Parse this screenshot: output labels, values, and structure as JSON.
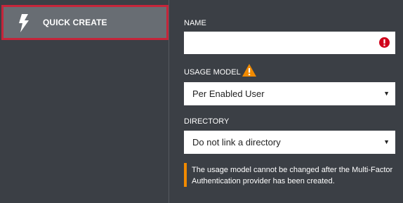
{
  "sidebar": {
    "quick_create_label": "QUICK CREATE",
    "icon": "lightning-bolt-icon",
    "highlight_color": "#c5253a"
  },
  "form": {
    "name_label": "NAME",
    "name_value": "",
    "name_error_icon": "error-icon",
    "usage_model_label": "USAGE MODEL",
    "usage_model_warning_icon": "warning-icon",
    "usage_model_value": "Per Enabled User",
    "directory_label": "DIRECTORY",
    "directory_value": "Do not link a directory",
    "dropdown_arrow": "▼",
    "note_text": "The usage model cannot be changed after the Multi-Factor Authentication provider has been created.",
    "note_accent_color": "#f18a00",
    "error_color": "#d0021b",
    "warning_color": "#f18a00"
  }
}
